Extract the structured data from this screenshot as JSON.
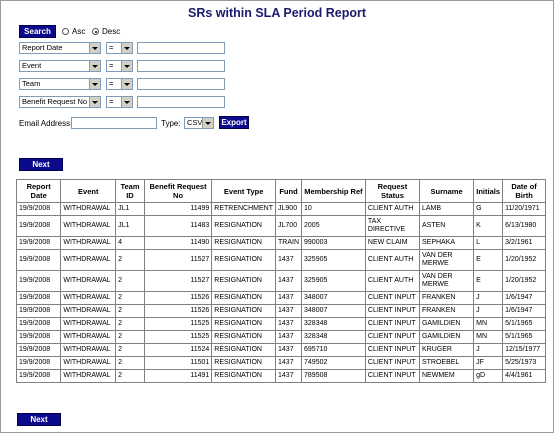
{
  "title": "SRs within SLA Period Report",
  "search_label": "Search",
  "sort": {
    "asc_label": "Asc",
    "desc_label": "Desc",
    "selected": "Desc"
  },
  "filters": [
    {
      "field": "Report Date",
      "operator": "=",
      "value": ""
    },
    {
      "field": "Event",
      "operator": "=",
      "value": ""
    },
    {
      "field": "Team",
      "operator": "=",
      "value": ""
    },
    {
      "field": "Benefit Request No",
      "operator": "=",
      "value": ""
    }
  ],
  "email": {
    "label": "Email Address:",
    "value": "",
    "type_label": "Type:",
    "type_value": "CSV",
    "export_label": "Export"
  },
  "next_label": "Next",
  "table": {
    "headers": [
      "Report Date",
      "Event",
      "Team ID",
      "Benefit Request No",
      "Event Type",
      "Fund",
      "Membership Ref",
      "Request Status",
      "Surname",
      "Initials",
      "Date of Birth"
    ],
    "rows": [
      [
        "19/9/2008",
        "WITHDRAWAL",
        "JL1",
        "11499",
        "RETRENCHMENT",
        "JL900",
        "10",
        "CLIENT AUTH",
        "LAMB",
        "G",
        "11/20/1971"
      ],
      [
        "19/9/2008",
        "WITHDRAWAL",
        "JL1",
        "11483",
        "RESIGNATION",
        "JL700",
        "2005",
        "TAX DIRECTIVE",
        "ASTEN",
        "K",
        "6/13/1980"
      ],
      [
        "19/9/2008",
        "WITHDRAWAL",
        "4",
        "11490",
        "RESIGNATION",
        "TRAIN",
        "990003",
        "NEW CLAIM",
        "SEPHAKA",
        "L",
        "3/2/1961"
      ],
      [
        "19/9/2008",
        "WITHDRAWAL",
        "2",
        "11527",
        "RESIGNATION",
        "1437",
        "325905",
        "CLIENT AUTH",
        "VAN DER MERWE",
        "E",
        "1/20/1952"
      ],
      [
        "19/9/2008",
        "WITHDRAWAL",
        "2",
        "11527",
        "RESIGNATION",
        "1437",
        "325905",
        "CLIENT AUTH",
        "VAN DER MERWE",
        "E",
        "1/20/1952"
      ],
      [
        "19/9/2008",
        "WITHDRAWAL",
        "2",
        "11526",
        "RESIGNATION",
        "1437",
        "348007",
        "CLIENT INPUT",
        "FRANKEN",
        "J",
        "1/6/1947"
      ],
      [
        "19/9/2008",
        "WITHDRAWAL",
        "2",
        "11526",
        "RESIGNATION",
        "1437",
        "348007",
        "CLIENT INPUT",
        "FRANKEN",
        "J",
        "1/6/1947"
      ],
      [
        "19/9/2008",
        "WITHDRAWAL",
        "2",
        "11525",
        "RESIGNATION",
        "1437",
        "328348",
        "CLIENT INPUT",
        "GAMILDIEN",
        "MN",
        "5/1/1965"
      ],
      [
        "19/9/2008",
        "WITHDRAWAL",
        "2",
        "11525",
        "RESIGNATION",
        "1437",
        "328348",
        "CLIENT INPUT",
        "GAMILDIEN",
        "MN",
        "5/1/1965"
      ],
      [
        "19/9/2008",
        "WITHDRAWAL",
        "2",
        "11524",
        "RESIGNATION",
        "1437",
        "695710",
        "CLIENT INPUT",
        "KRUGER",
        "J",
        "12/15/1977"
      ],
      [
        "19/9/2008",
        "WITHDRAWAL",
        "2",
        "11501",
        "RESIGNATION",
        "1437",
        "749502",
        "CLIENT INPUT",
        "STROEBEL",
        "JF",
        "5/25/1973"
      ],
      [
        "19/9/2008",
        "WITHDRAWAL",
        "2",
        "11491",
        "RESIGNATION",
        "1437",
        "789508",
        "CLIENT INPUT",
        "NEWMEM",
        "gD",
        "4/4/1961"
      ]
    ]
  }
}
